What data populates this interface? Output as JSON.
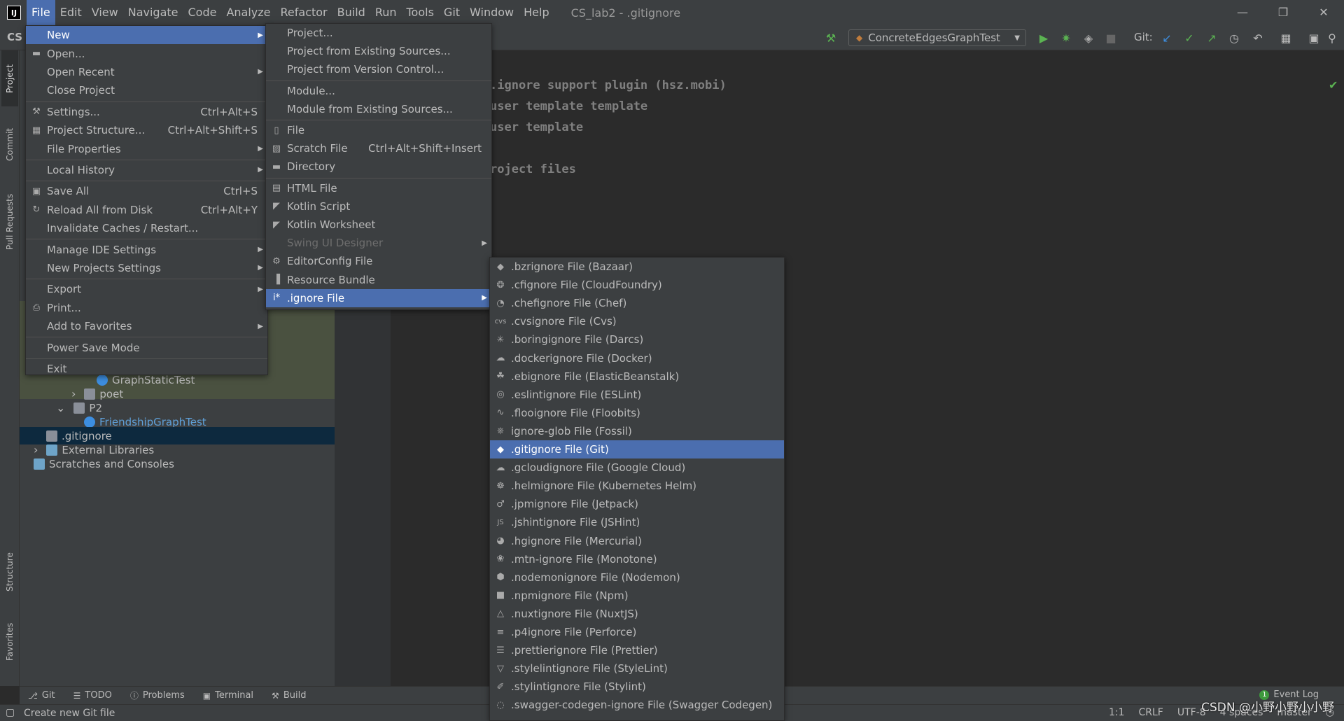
{
  "window": {
    "title": "CS_lab2 - .gitignore",
    "app_short": "CS",
    "logo_text": "IJ"
  },
  "menubar": [
    "File",
    "Edit",
    "View",
    "Navigate",
    "Code",
    "Analyze",
    "Refactor",
    "Build",
    "Run",
    "Tools",
    "Git",
    "Window",
    "Help"
  ],
  "toolbar": {
    "run_config": "ConcreteEdgesGraphTest",
    "git_label": "Git:"
  },
  "left_tabs": [
    "Project",
    "Commit",
    "Pull Requests",
    "Structure",
    "Favorites"
  ],
  "project_tree": [
    {
      "label": "GraphStaticTest",
      "kind": "test-class"
    },
    {
      "label": "poet",
      "kind": "folder"
    },
    {
      "label": "P2",
      "kind": "folder-open"
    },
    {
      "label": "FriendshipGraphTest",
      "kind": "test-class"
    },
    {
      "label": ".gitignore",
      "kind": "gitignore"
    },
    {
      "label": "External Libraries",
      "kind": "library"
    },
    {
      "label": "Scratches and Consoles",
      "kind": "scratch"
    }
  ],
  "editor_lines": [
    ".ignore support plugin (hsz.mobi)",
    "user template template",
    "user template",
    "",
    "roject files"
  ],
  "file_menu": [
    {
      "label": "New",
      "arrow": true,
      "active": true
    },
    {
      "label": "Open...",
      "icon": "folder-icon"
    },
    {
      "label": "Open Recent",
      "arrow": true
    },
    {
      "label": "Close Project"
    },
    {
      "sep": true
    },
    {
      "label": "Settings...",
      "shortcut": "Ctrl+Alt+S",
      "icon": "wrench-icon"
    },
    {
      "label": "Project Structure...",
      "shortcut": "Ctrl+Alt+Shift+S",
      "icon": "project-structure-icon"
    },
    {
      "label": "File Properties",
      "arrow": true
    },
    {
      "sep": true
    },
    {
      "label": "Local History",
      "arrow": true
    },
    {
      "sep": true
    },
    {
      "label": "Save All",
      "shortcut": "Ctrl+S",
      "icon": "save-icon"
    },
    {
      "label": "Reload All from Disk",
      "shortcut": "Ctrl+Alt+Y",
      "icon": "reload-icon"
    },
    {
      "label": "Invalidate Caches / Restart..."
    },
    {
      "sep": true
    },
    {
      "label": "Manage IDE Settings",
      "arrow": true
    },
    {
      "label": "New Projects Settings",
      "arrow": true
    },
    {
      "sep": true
    },
    {
      "label": "Export",
      "arrow": true
    },
    {
      "label": "Print...",
      "icon": "print-icon"
    },
    {
      "label": "Add to Favorites",
      "arrow": true
    },
    {
      "sep": true
    },
    {
      "label": "Power Save Mode"
    },
    {
      "sep": true
    },
    {
      "label": "Exit"
    }
  ],
  "new_menu": [
    {
      "label": "Project..."
    },
    {
      "label": "Project from Existing Sources..."
    },
    {
      "label": "Project from Version Control..."
    },
    {
      "sep": true
    },
    {
      "label": "Module..."
    },
    {
      "label": "Module from Existing Sources..."
    },
    {
      "sep": true
    },
    {
      "label": "File",
      "icon": "file-icon"
    },
    {
      "label": "Scratch File",
      "shortcut": "Ctrl+Alt+Shift+Insert",
      "icon": "scratch-icon"
    },
    {
      "label": "Directory",
      "icon": "folder-icon"
    },
    {
      "sep": true
    },
    {
      "label": "HTML File",
      "icon": "html-icon"
    },
    {
      "label": "Kotlin Script",
      "icon": "kotlin-icon"
    },
    {
      "label": "Kotlin Worksheet",
      "icon": "kotlin-icon"
    },
    {
      "label": "Swing UI Designer",
      "arrow": true,
      "disabled": true
    },
    {
      "label": "EditorConfig File",
      "icon": "gear-icon"
    },
    {
      "label": "Resource Bundle",
      "icon": "bundle-icon"
    },
    {
      "label": ".ignore File",
      "arrow": true,
      "active": true,
      "icon": "ignore-icon"
    }
  ],
  "ignore_menu": [
    {
      "label": ".bzrignore File (Bazaar)",
      "icon": "bazaar-icon"
    },
    {
      "label": ".cfignore File (CloudFoundry)",
      "icon": "cloudfoundry-icon"
    },
    {
      "label": ".chefignore File (Chef)",
      "icon": "chef-icon"
    },
    {
      "label": ".cvsignore File (Cvs)",
      "icon": "cvs-icon",
      "icon_text": "cvs"
    },
    {
      "label": ".boringignore File (Darcs)",
      "icon": "darcs-icon"
    },
    {
      "label": ".dockerignore File (Docker)",
      "icon": "docker-icon"
    },
    {
      "label": ".ebignore File (ElasticBeanstalk)",
      "icon": "elasticbeanstalk-icon"
    },
    {
      "label": ".eslintignore File (ESLint)",
      "icon": "eslint-icon"
    },
    {
      "label": ".flooignore File (Floobits)",
      "icon": "floobits-icon"
    },
    {
      "label": "ignore-glob File (Fossil)",
      "icon": "fossil-icon"
    },
    {
      "label": ".gitignore File (Git)",
      "icon": "git-icon",
      "active": true
    },
    {
      "label": ".gcloudignore File (Google Cloud)",
      "icon": "gcloud-icon"
    },
    {
      "label": ".helmignore File (Kubernetes Helm)",
      "icon": "helm-icon"
    },
    {
      "label": ".jpmignore File (Jetpack)",
      "icon": "jetpack-icon"
    },
    {
      "label": ".jshintignore File (JSHint)",
      "icon": "jshint-icon",
      "icon_text": "JS"
    },
    {
      "label": ".hgignore File (Mercurial)",
      "icon": "mercurial-icon"
    },
    {
      "label": ".mtn-ignore File (Monotone)",
      "icon": "monotone-icon"
    },
    {
      "label": ".nodemonignore File (Nodemon)",
      "icon": "nodemon-icon"
    },
    {
      "label": ".npmignore File (Npm)",
      "icon": "npm-icon"
    },
    {
      "label": ".nuxtignore File (NuxtJS)",
      "icon": "nuxt-icon"
    },
    {
      "label": ".p4ignore File (Perforce)",
      "icon": "perforce-icon"
    },
    {
      "label": ".prettierignore File (Prettier)",
      "icon": "prettier-icon"
    },
    {
      "label": ".stylelintignore File (StyleLint)",
      "icon": "stylelint-icon"
    },
    {
      "label": ".stylintignore File (Stylint)",
      "icon": "stylint-icon"
    },
    {
      "label": ".swagger-codegen-ignore File (Swagger Codegen)",
      "icon": "swagger-icon"
    }
  ],
  "bottom_tabs": [
    {
      "label": "Git",
      "icon": "git-branch-icon"
    },
    {
      "label": "TODO",
      "icon": "todo-icon"
    },
    {
      "label": "Problems",
      "icon": "problems-icon"
    },
    {
      "label": "Terminal",
      "icon": "terminal-icon"
    },
    {
      "label": "Build",
      "icon": "build-icon"
    }
  ],
  "event_log": {
    "label": "Event Log",
    "count": "1"
  },
  "statusbar": {
    "message": "Create new Git file",
    "position": "1:1",
    "line_sep": "CRLF",
    "encoding": "UTF-8",
    "indent": "4 spaces",
    "branch": "master"
  },
  "watermark": "CSDN @小野小野小小野",
  "colors": {
    "accent": "#4b6eaf",
    "bg": "#3c3f41",
    "editor_bg": "#2b2b2b",
    "selection_dark": "#0d293e",
    "green": "#5bb352"
  }
}
